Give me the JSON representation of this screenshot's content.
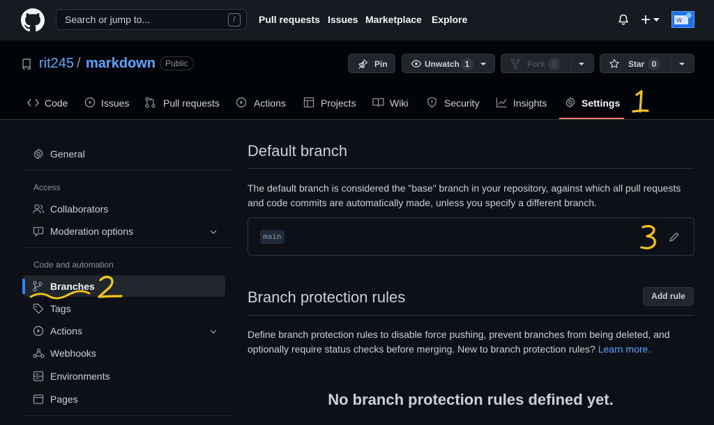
{
  "header": {
    "search_placeholder": "Search or jump to...",
    "search_shortcut": "/",
    "nav": [
      "Pull requests",
      "Issues",
      "Marketplace",
      "Explore"
    ]
  },
  "repo": {
    "owner": "rit245",
    "separator": "/",
    "name": "markdown",
    "visibility": "Public",
    "pin_label": "Pin",
    "unwatch_label": "Unwatch",
    "unwatch_count": "1",
    "fork_label": "Fork",
    "fork_count": "0",
    "star_label": "Star",
    "star_count": "0"
  },
  "tabs": [
    {
      "label": "Code",
      "icon": "code-icon"
    },
    {
      "label": "Issues",
      "icon": "issue-icon"
    },
    {
      "label": "Pull requests",
      "icon": "pull-request-icon"
    },
    {
      "label": "Actions",
      "icon": "play-icon"
    },
    {
      "label": "Projects",
      "icon": "table-icon"
    },
    {
      "label": "Wiki",
      "icon": "book-icon"
    },
    {
      "label": "Security",
      "icon": "shield-icon"
    },
    {
      "label": "Insights",
      "icon": "graph-icon"
    },
    {
      "label": "Settings",
      "icon": "gear-icon",
      "selected": true
    }
  ],
  "sidebar": {
    "general": "General",
    "access_heading": "Access",
    "collaborators": "Collaborators",
    "moderation": "Moderation options",
    "code_heading": "Code and automation",
    "branches": "Branches",
    "tags": "Tags",
    "actions": "Actions",
    "webhooks": "Webhooks",
    "environments": "Environments",
    "pages": "Pages"
  },
  "main": {
    "default_branch_title": "Default branch",
    "default_branch_desc_1": "The default branch is considered the \"base\" branch in your repository, against which all pull requests",
    "default_branch_desc_2": "and code commits are automatically made, unless you specify a different branch.",
    "branch_name": "main",
    "protection_title": "Branch protection rules",
    "add_rule": "Add rule",
    "protection_desc_1": "Define branch protection rules to disable force pushing, prevent branches from being deleted, and",
    "protection_desc_2": "optionally require status checks before merging. New to branch protection rules?",
    "learn_more": "Learn more.",
    "empty_state": "No branch protection rules defined yet."
  },
  "annotations": {
    "one": "1",
    "two": "2",
    "three": "3",
    "color": "#f5c518"
  },
  "colors": {
    "accent": "#f78166",
    "link": "#58a6ff",
    "active_bar": "#2f81f7"
  }
}
